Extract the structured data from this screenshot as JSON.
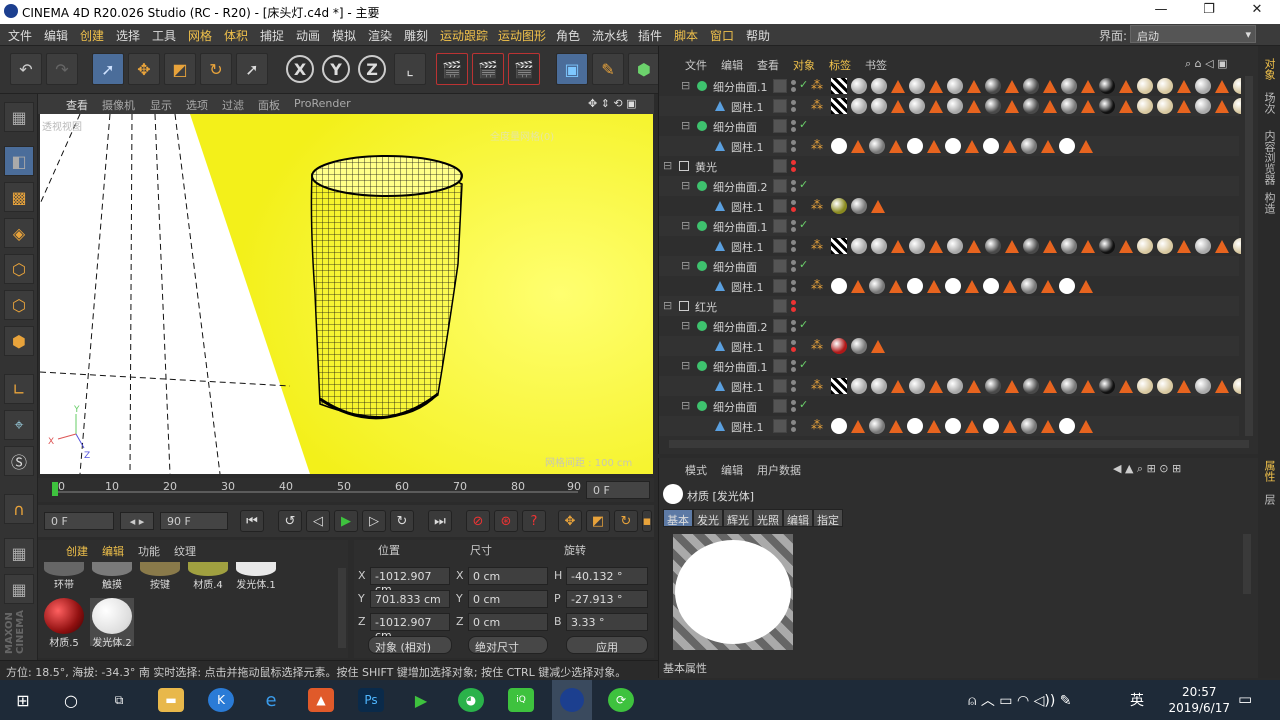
{
  "window": {
    "title": "CINEMA 4D R20.026 Studio (RC - R20) - [床头灯.c4d *] - 主要"
  },
  "menu": {
    "items": [
      "文件",
      "编辑",
      "创建",
      "选择",
      "工具",
      "网格",
      "体积",
      "捕捉",
      "动画",
      "模拟",
      "渲染",
      "雕刻",
      "运动跟踪",
      "运动图形",
      "角色",
      "流水线",
      "插件",
      "脚本",
      "窗口",
      "帮助"
    ],
    "interface_label": "界面:",
    "interface_value": "启动"
  },
  "viewport": {
    "tabs": [
      "查看",
      "摄像机",
      "显示",
      "选项",
      "过滤",
      "面板",
      "ProRender"
    ],
    "view_name": "透视视图",
    "grid_spacing": "网格间距 : 100 cm",
    "overlay_text": "全度量网格(0)"
  },
  "timeline": {
    "ticks": [
      "0",
      "10",
      "20",
      "30",
      "40",
      "50",
      "60",
      "70",
      "80",
      "90"
    ],
    "current_frame": "0 F"
  },
  "transport": {
    "start": "0 F",
    "end": "90 F"
  },
  "materials": {
    "tabs": [
      "创建",
      "编辑",
      "功能",
      "纹理"
    ],
    "items": [
      {
        "name": "环带",
        "color": "#666666"
      },
      {
        "name": "触摸",
        "color": "#7a7a7a"
      },
      {
        "name": "按键",
        "color": "#8a7a4a"
      },
      {
        "name": "材质.4",
        "color": "#a0a040"
      },
      {
        "name": "发光体.1",
        "color": "#e8e8e8"
      },
      {
        "name": "材质.5",
        "color": "#b01818"
      },
      {
        "name": "发光体.2",
        "color": "#f2f2f2"
      }
    ]
  },
  "coords": {
    "headers": [
      "位置",
      "尺寸",
      "旋转"
    ],
    "rows": [
      {
        "axis": "X",
        "pos": "-1012.907 cm",
        "size_axis": "X",
        "size": "0 cm",
        "rot_axis": "H",
        "rot": "-40.132 °"
      },
      {
        "axis": "Y",
        "pos": "701.833 cm",
        "size_axis": "Y",
        "size": "0 cm",
        "rot_axis": "P",
        "rot": "-27.913 °"
      },
      {
        "axis": "Z",
        "pos": "-1012.907 cm",
        "size_axis": "Z",
        "size": "0 cm",
        "rot_axis": "B",
        "rot": "3.33 °"
      }
    ],
    "mode": "对象 (相对)",
    "size_mode": "绝对尺寸",
    "apply": "应用"
  },
  "status": "方位: 18.5°, 海拔: -34.3° 南      实时选择: 点击并拖动鼠标选择元素。按住 SHIFT 键增加选择对象; 按住 CTRL 键减少选择对象。",
  "object_manager": {
    "menu": [
      "文件",
      "编辑",
      "查看",
      "对象",
      "标签",
      "书签"
    ],
    "rows": [
      {
        "name": "细分曲面.1",
        "type": "sub",
        "indent": 1,
        "tags": "long"
      },
      {
        "name": "圆柱.1",
        "type": "cyl",
        "indent": 2,
        "tags": "long"
      },
      {
        "name": "细分曲面",
        "type": "sub",
        "indent": 1,
        "tags": "none"
      },
      {
        "name": "圆柱.1",
        "type": "cyl",
        "indent": 2,
        "tags": "white"
      },
      {
        "name": "黄光",
        "type": "null",
        "indent": 0,
        "tags": "none"
      },
      {
        "name": "细分曲面.2",
        "type": "sub",
        "indent": 1,
        "tags": "none"
      },
      {
        "name": "圆柱.1",
        "type": "cyl",
        "indent": 2,
        "tags": "yellow"
      },
      {
        "name": "细分曲面.1",
        "type": "sub",
        "indent": 1,
        "tags": "none"
      },
      {
        "name": "圆柱.1",
        "type": "cyl",
        "indent": 2,
        "tags": "long"
      },
      {
        "name": "细分曲面",
        "type": "sub",
        "indent": 1,
        "tags": "none"
      },
      {
        "name": "圆柱.1",
        "type": "cyl",
        "indent": 2,
        "tags": "white"
      },
      {
        "name": "红光",
        "type": "null",
        "indent": 0,
        "tags": "none"
      },
      {
        "name": "细分曲面.2",
        "type": "sub",
        "indent": 1,
        "tags": "none"
      },
      {
        "name": "圆柱.1",
        "type": "cyl",
        "indent": 2,
        "tags": "red"
      },
      {
        "name": "细分曲面.1",
        "type": "sub",
        "indent": 1,
        "tags": "none"
      },
      {
        "name": "圆柱.1",
        "type": "cyl",
        "indent": 2,
        "tags": "long"
      },
      {
        "name": "细分曲面",
        "type": "sub",
        "indent": 1,
        "tags": "none"
      },
      {
        "name": "圆柱.1",
        "type": "cyl",
        "indent": 2,
        "tags": "white"
      }
    ]
  },
  "attributes": {
    "menu": [
      "模式",
      "编辑",
      "用户数据"
    ],
    "title": "材质 [发光体]",
    "tabs": [
      "基本",
      "发光",
      "辉光",
      "光照",
      "编辑",
      "指定"
    ],
    "section": "基本属性"
  },
  "right_strip": [
    "对象",
    "场次",
    "内容浏览器",
    "构造",
    "属性",
    "层"
  ],
  "taskbar": {
    "time": "20:57",
    "date": "2019/6/17",
    "lang": "英"
  }
}
